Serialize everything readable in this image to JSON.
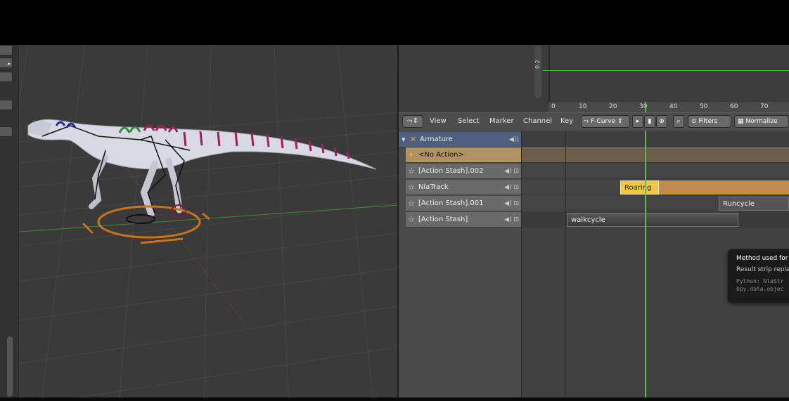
{
  "graph_editor": {
    "value_label": "0.2",
    "ruler_ticks": [
      "0",
      "10",
      "20",
      "30",
      "40",
      "50",
      "60",
      "70"
    ],
    "curve_color": "#4ac03c"
  },
  "nla_header": {
    "editor_type_icon": "nla-editor-icon",
    "menus": [
      "View",
      "Select",
      "Marker",
      "Channel",
      "Key"
    ],
    "mode_dropdown": "F-Curve",
    "filters_label": "Filters",
    "normalize_label": "Normalize"
  },
  "channels": [
    {
      "label": "Armature",
      "kind": "object"
    },
    {
      "label": "<No Action>",
      "kind": "action"
    },
    {
      "label": "[Action Stash].002",
      "kind": "track"
    },
    {
      "label": "NlaTrack",
      "kind": "track"
    },
    {
      "label": "[Action Stash].001",
      "kind": "track"
    },
    {
      "label": "[Action Stash]",
      "kind": "track"
    }
  ],
  "strips": {
    "roaring": "Roaring",
    "runcycle": "Runcycle",
    "walkcycle": "walkcycle"
  },
  "tooltip": {
    "title": "Method used for",
    "description": "Result strip repla",
    "python_line1": "Python: NlaStr",
    "python_line2": "bpy.data.objec"
  },
  "colors": {
    "playhead": "#56c24a",
    "armature_row": "#4d607e",
    "no_action_row": "#b09263",
    "active_strip": "#f4c54a",
    "selected_track": "#c48a4e"
  }
}
